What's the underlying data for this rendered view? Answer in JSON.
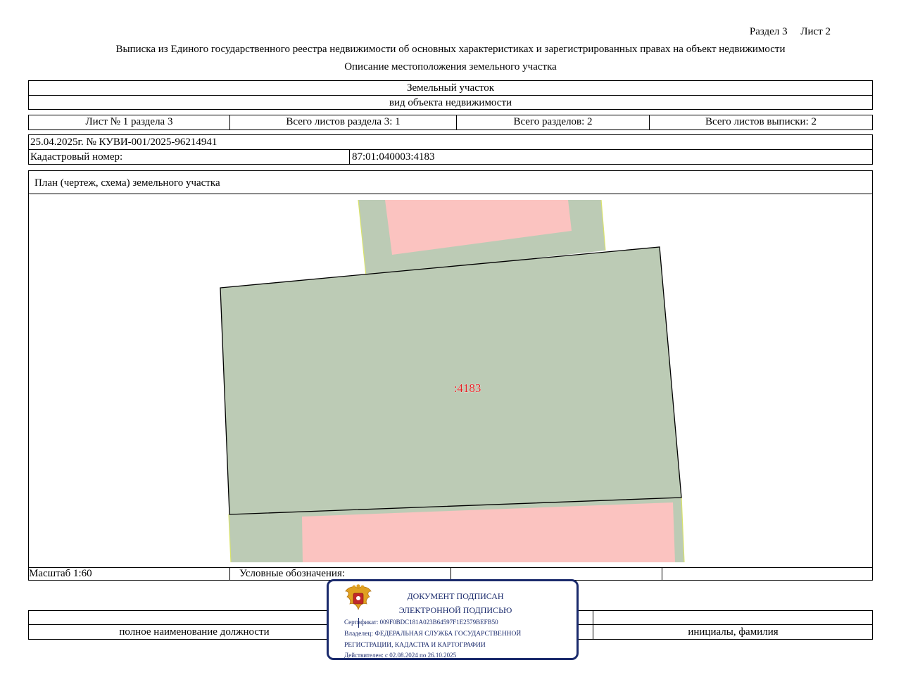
{
  "header": {
    "section_label": "Раздел 3",
    "sheet_label": "Лист 2",
    "title": "Выписка из Единого государственного реестра недвижимости об основных характеристиках и зарегистрированных правах на объект недвижимости",
    "subtitle": "Описание местоположения земельного участка"
  },
  "object": {
    "type": "Земельный участок",
    "type_caption": "вид объекта недвижимости"
  },
  "sheets": [
    "Лист № 1 раздела 3",
    "Всего листов раздела 3: 1",
    "Всего разделов: 2",
    "Всего листов выписки: 2"
  ],
  "record": {
    "date_number": "25.04.2025г. № КУВИ-001/2025-96214941",
    "cadastral_label": "Кадастровый номер:",
    "cadastral_value": "87:01:040003:4183"
  },
  "plan": {
    "title": "План (чертеж, схема) земельного участка",
    "parcel_label": ":4183",
    "colors": {
      "parcel_fill": "#bccbb5",
      "building_fill": "#fbc3c0",
      "parcel_stroke": "#000000",
      "label_color": "#e02020",
      "edge_highlight": "#d9e36a"
    }
  },
  "footer": {
    "scale": "Масштаб 1:60",
    "legend_label": "Условные обозначения:",
    "position_caption": "полное наименование должности",
    "name_caption": "инициалы, фамилия"
  },
  "stamp": {
    "line1": "ДОКУМЕНТ ПОДПИСАН",
    "line2": "ЭЛЕКТРОННОЙ ПОДПИСЬЮ",
    "certificate": "Сертификат: 009F0BDC181A023B64597F1E2579BEFB50",
    "owner_line1": "Владелец: ФЕДЕРАЛЬНАЯ СЛУЖБА ГОСУДАРСТВЕННОЙ",
    "owner_line2": "РЕГИСТРАЦИИ, КАДАСТРА И КАРТОГРАФИИ",
    "valid": "Действителен: с 02.08.2024 по 26.10.2025"
  }
}
